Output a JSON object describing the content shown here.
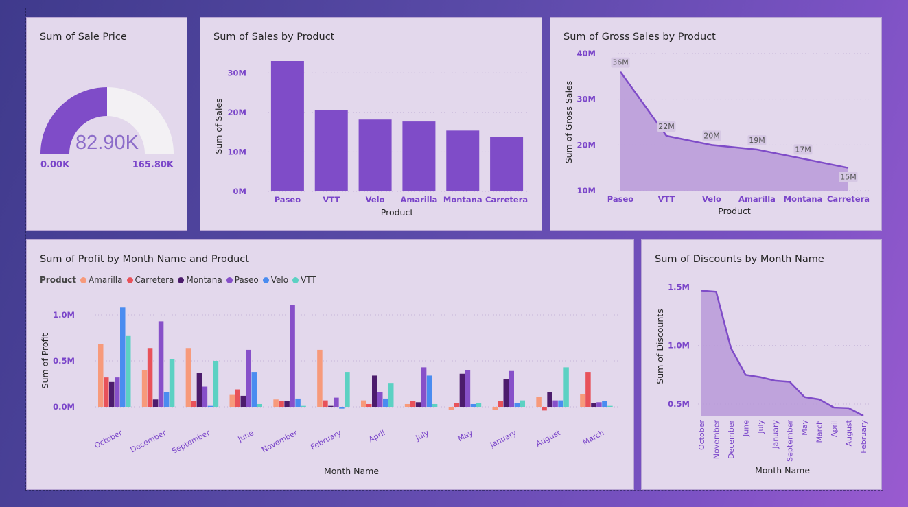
{
  "colors": {
    "primary": "#7f4cc8",
    "area_fill": "#b89ad9",
    "gauge_empty": "#f3f1f4",
    "tick": "#7a45c9"
  },
  "cards": {
    "gauge_title": "Sum of Sale Price",
    "sales_title": "Sum of Sales by Product",
    "gross_title": "Sum of Gross Sales by Product",
    "profit_title": "Sum of Profit by Month Name and Product",
    "discounts_title": "Sum of Discounts by Month Name"
  },
  "chart_data": [
    {
      "id": "gauge",
      "type": "gauge",
      "title": "Sum of Sale Price",
      "value": 82.9,
      "min": 0,
      "max": 165.8,
      "value_label": "82.90K",
      "min_label": "0.00K",
      "max_label": "165.80K"
    },
    {
      "id": "sales",
      "type": "bar",
      "title": "Sum of Sales by Product",
      "xlabel": "Product",
      "ylabel": "Sum of Sales",
      "categories": [
        "Paseo",
        "VTT",
        "Velo",
        "Amarilla",
        "Montana",
        "Carretera"
      ],
      "values": [
        33,
        20.5,
        18.2,
        17.7,
        15.4,
        13.8
      ],
      "ylim": [
        0,
        33
      ],
      "yticks": [
        0,
        10,
        20,
        30
      ],
      "ytick_labels": [
        "0M",
        "10M",
        "20M",
        "30M"
      ],
      "grid": true
    },
    {
      "id": "gross",
      "type": "area",
      "title": "Sum of Gross Sales by Product",
      "xlabel": "Product",
      "ylabel": "Sum of Gross Sales",
      "categories": [
        "Paseo",
        "VTT",
        "Velo",
        "Amarilla",
        "Montana",
        "Carretera"
      ],
      "values": [
        36,
        22,
        20,
        19,
        17,
        15
      ],
      "data_labels": [
        "36M",
        "22M",
        "20M",
        "19M",
        "17M",
        "15M"
      ],
      "ylim": [
        10,
        40
      ],
      "yticks": [
        10,
        20,
        30,
        40
      ],
      "ytick_labels": [
        "10M",
        "20M",
        "30M",
        "40M"
      ],
      "grid": true
    },
    {
      "id": "profit",
      "type": "bar",
      "title": "Sum of Profit by Month Name and Product",
      "xlabel": "Month Name",
      "ylabel": "Sum of Profit",
      "legend_title": "Product",
      "legend_position": "top-left",
      "categories": [
        "October",
        "December",
        "September",
        "June",
        "November",
        "February",
        "April",
        "July",
        "May",
        "January",
        "August",
        "March"
      ],
      "series": [
        {
          "name": "Amarilla",
          "color": "#f79a7b",
          "values": [
            0.68,
            0.4,
            0.64,
            0.13,
            0.08,
            0.62,
            0.07,
            0.03,
            -0.03,
            -0.03,
            0.11,
            0.14
          ]
        },
        {
          "name": "Carretera",
          "color": "#e8525a",
          "values": [
            0.32,
            0.64,
            0.06,
            0.19,
            0.06,
            0.07,
            0.03,
            0.06,
            0.04,
            0.06,
            -0.04,
            0.38
          ]
        },
        {
          "name": "Montana",
          "color": "#4c1c6c",
          "values": [
            0.27,
            0.08,
            0.37,
            0.12,
            0.06,
            0.01,
            0.34,
            0.05,
            0.36,
            0.3,
            0.16,
            0.04
          ]
        },
        {
          "name": "Paseo",
          "color": "#8750c9",
          "values": [
            0.32,
            0.93,
            0.22,
            0.62,
            1.11,
            0.1,
            0.16,
            0.43,
            0.4,
            0.39,
            0.07,
            0.05
          ]
        },
        {
          "name": "Velo",
          "color": "#4a8cf0",
          "values": [
            1.08,
            0.16,
            0.01,
            0.38,
            0.09,
            -0.02,
            0.09,
            0.34,
            0.03,
            0.04,
            0.07,
            0.06
          ]
        },
        {
          "name": "VTT",
          "color": "#5cd1c3",
          "values": [
            0.77,
            0.52,
            0.5,
            0.03,
            0.01,
            0.38,
            0.26,
            0.03,
            0.04,
            0.07,
            0.43,
            0.01
          ]
        }
      ],
      "ylim": [
        -0.1,
        1.15
      ],
      "yticks": [
        0,
        0.5,
        1.0
      ],
      "ytick_labels": [
        "0.0M",
        "0.5M",
        "1.0M"
      ],
      "grid": true
    },
    {
      "id": "discounts",
      "type": "area",
      "title": "Sum of Discounts by Month Name",
      "xlabel": "Month Name",
      "ylabel": "Sum of Discounts",
      "categories": [
        "October",
        "November",
        "December",
        "June",
        "July",
        "January",
        "September",
        "May",
        "March",
        "April",
        "August",
        "February"
      ],
      "values": [
        1.47,
        1.46,
        0.98,
        0.75,
        0.73,
        0.7,
        0.69,
        0.56,
        0.54,
        0.47,
        0.465,
        0.4
      ],
      "ylim": [
        0.4,
        1.5
      ],
      "yticks": [
        0.5,
        1.0,
        1.5
      ],
      "ytick_labels": [
        "0.5M",
        "1.0M",
        "1.5M"
      ],
      "grid": true
    }
  ]
}
